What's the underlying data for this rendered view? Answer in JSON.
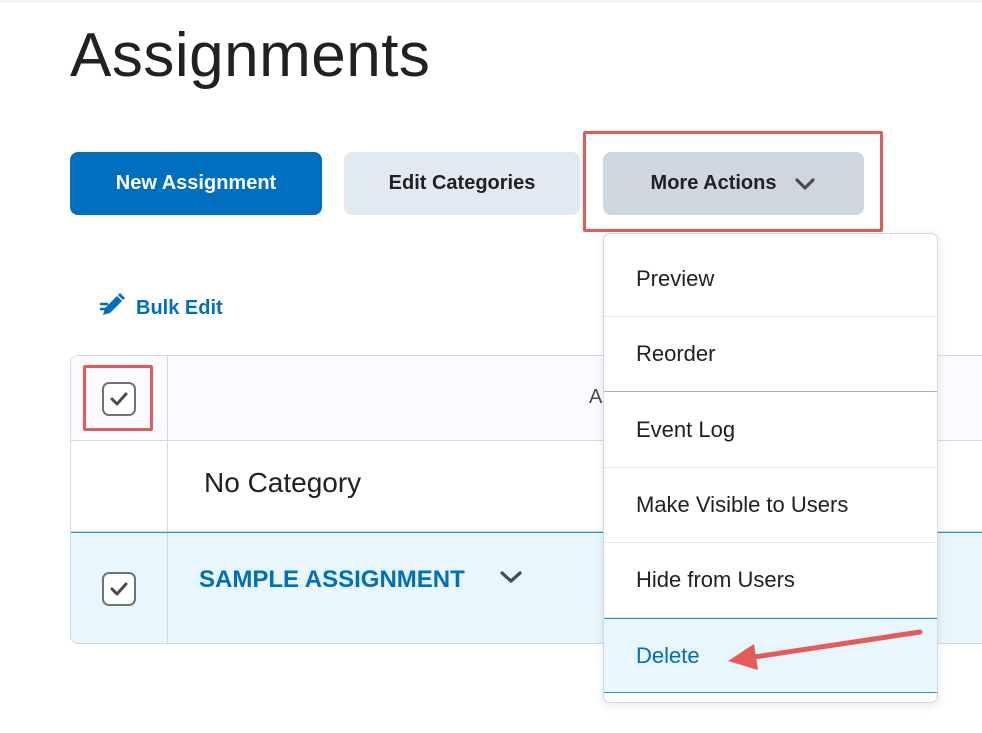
{
  "page": {
    "title": "Assignments"
  },
  "toolbar": {
    "new_assignment_label": "New Assignment",
    "edit_categories_label": "Edit Categories",
    "more_actions_label": "More Actions"
  },
  "bulk_edit": {
    "label": "Bulk Edit",
    "icon": "pencil-icon"
  },
  "table": {
    "header_partial": "A",
    "category": "No Category",
    "rows": [
      {
        "title": "SAMPLE ASSIGNMENT",
        "checked": true
      }
    ],
    "header_checked": true
  },
  "menu": {
    "items": [
      {
        "label": "Preview"
      },
      {
        "label": "Reorder"
      },
      {
        "label": "Event Log"
      },
      {
        "label": "Make Visible to Users"
      },
      {
        "label": "Hide from Users"
      },
      {
        "label": "Delete",
        "selected": true
      }
    ]
  },
  "colors": {
    "primary": "#006fbf",
    "annotation_red": "#e55a5a",
    "selected_bg": "#e8f6fe"
  }
}
